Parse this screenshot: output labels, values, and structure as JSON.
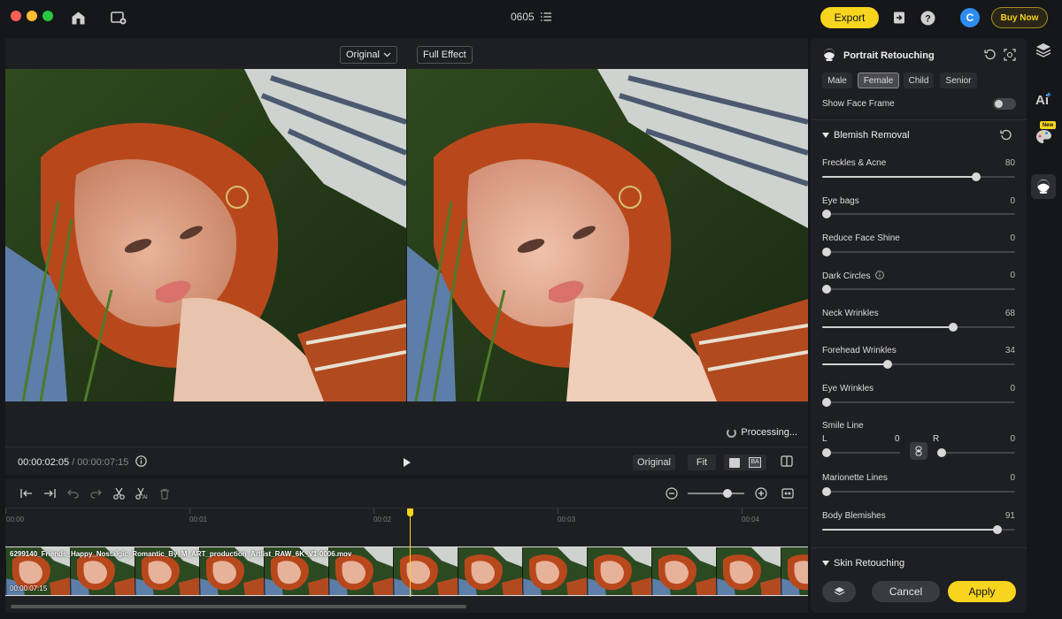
{
  "titlebar": {
    "doc_title": "0605",
    "export_label": "Export",
    "avatar_initial": "C",
    "buy_now_label": "Buy Now"
  },
  "preview": {
    "original_dropdown": "Original",
    "full_effect_label": "Full Effect",
    "processing_text": "Processing...",
    "current_time": "00:00:02:05",
    "total_time": "/ 00:00:07:15",
    "original_btn": "Original",
    "fit_btn": "Fit"
  },
  "timeline": {
    "ticks": [
      "00:00",
      "00:01",
      "00:02",
      "00:03",
      "00:04"
    ],
    "clip_name": "6299140_Friends_Happy_Nostalgic_Romantic_By_M_ART_production_Artlist_RAW_6K_V1-0006.mov",
    "clip_duration": "00:00:07:15",
    "zoom_level": 0.7
  },
  "panel": {
    "title": "Portrait Retouching",
    "genders": [
      {
        "label": "Male",
        "active": false
      },
      {
        "label": "Female",
        "active": true
      },
      {
        "label": "Child",
        "active": false
      },
      {
        "label": "Senior",
        "active": false
      }
    ],
    "show_face_frame_label": "Show Face Frame",
    "show_face_frame_on": false,
    "blemish_section": "Blemish Removal",
    "sliders": [
      {
        "label": "Freckles & Acne",
        "value": 80
      },
      {
        "label": "Eye bags",
        "value": 0
      },
      {
        "label": "Reduce Face Shine",
        "value": 0
      },
      {
        "label": "Dark Circles",
        "value": 0,
        "info": true
      },
      {
        "label": "Neck Wrinkles",
        "value": 68
      },
      {
        "label": "Forehead Wrinkles",
        "value": 34
      },
      {
        "label": "Eye Wrinkles",
        "value": 0
      }
    ],
    "smile_line": {
      "label": "Smile Line",
      "left_label": "L",
      "left_value": 0,
      "right_label": "R",
      "right_value": 0
    },
    "sliders_after": [
      {
        "label": "Marionette Lines",
        "value": 0
      },
      {
        "label": "Body Blemishes",
        "value": 91
      }
    ],
    "skin_section": "Skin Retouching",
    "cancel_label": "Cancel",
    "apply_label": "Apply"
  },
  "rail": {
    "new_badge": "New"
  },
  "colors": {
    "accent_yellow": "#f7d51f",
    "avatar_blue": "#2d8cf0",
    "panel_bg": "#1e1f23"
  }
}
